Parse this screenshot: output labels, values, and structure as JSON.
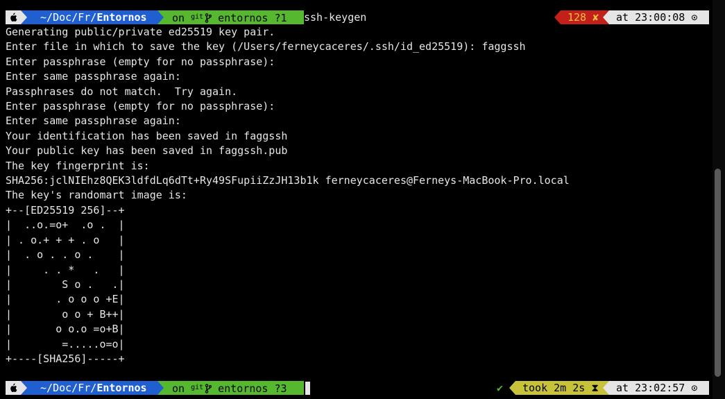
{
  "prompt1": {
    "apple_icon": "",
    "dir_prefix": " ~/Doc/Fr/",
    "dir_current": "Entornos",
    "git_on": "on ",
    "git_word": "git",
    "git_branch_icon": "",
    "git_branch": " entornos ?1",
    "command": "ssh-keygen",
    "exit_code": "128",
    "exit_icon": "✘",
    "time_label": "at 23:00:08",
    "clock_icon": "⊙"
  },
  "output_lines": [
    "Generating public/private ed25519 key pair.",
    "Enter file in which to save the key (/Users/ferneycaceres/.ssh/id_ed25519): faggssh",
    "Enter passphrase (empty for no passphrase):",
    "Enter same passphrase again:",
    "Passphrases do not match.  Try again.",
    "Enter passphrase (empty for no passphrase):",
    "Enter same passphrase again:",
    "Your identification has been saved in faggssh",
    "Your public key has been saved in faggssh.pub",
    "The key fingerprint is:",
    "SHA256:jclNIEhz8QEK3ldfdLq6dTt+Ry49SFupiiZzJH13b1k ferneycaceres@Ferneys-MacBook-Pro.local",
    "The key's randomart image is:",
    "+--[ED25519 256]--+",
    "|  ..o.=o+  .o .  |",
    "| . o.+ + + . o   |",
    "|  . o . . o .    |",
    "|     . . *   .   |",
    "|        S o .   .|",
    "|       . o o o +E|",
    "|        o o + B++|",
    "|       o o.o =o+B|",
    "|        =.....o=o|",
    "+----[SHA256]-----+"
  ],
  "prompt2": {
    "apple_icon": "",
    "dir_prefix": " ~/Doc/Fr/",
    "dir_current": "Entornos",
    "git_on": "on ",
    "git_word": "git",
    "git_branch_icon": "",
    "git_branch": " entornos ?3",
    "ok_icon": "✔",
    "took_label": "took 2m 2s",
    "hourglass_icon": "⧗",
    "time_label": "at 23:02:57",
    "clock_icon": "⊙"
  },
  "colors": {
    "dir_bg": "#1f5fd0",
    "git_bg": "#55b82f",
    "error_bg": "#c4201a",
    "time_bg": "#e5e5e5",
    "took_bg": "#c8c23a"
  }
}
